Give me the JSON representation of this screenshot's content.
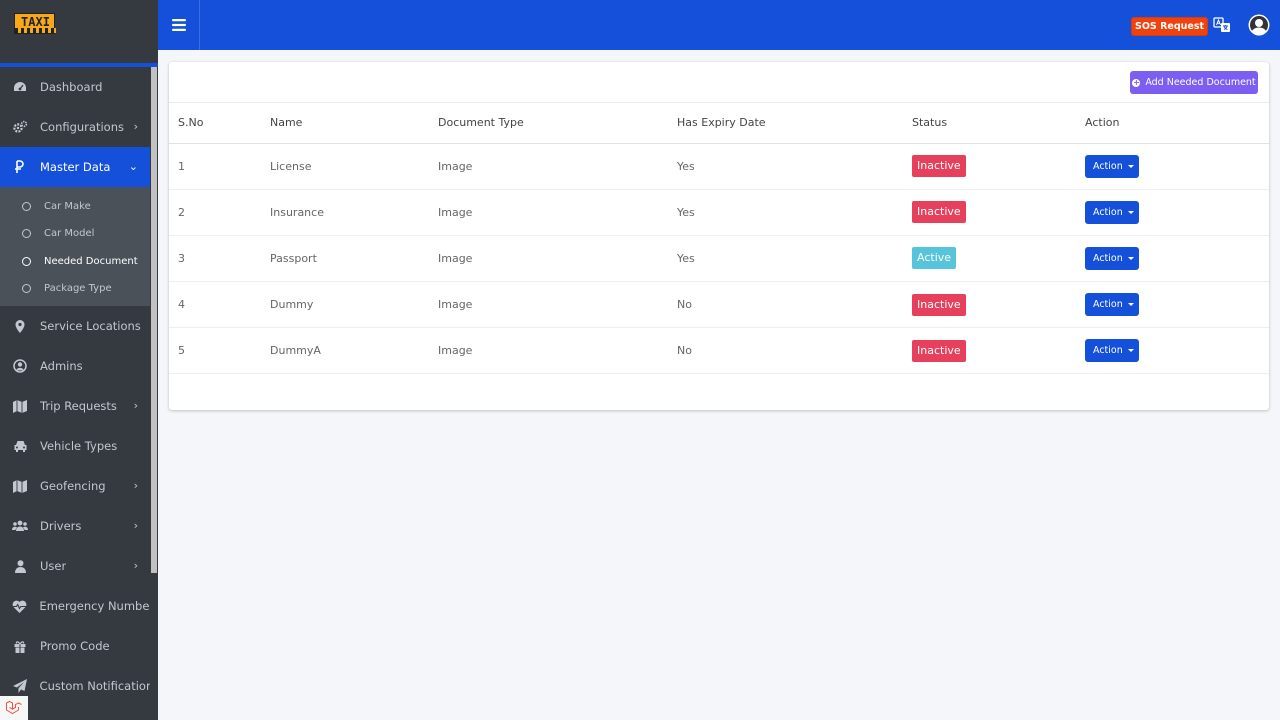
{
  "brand": {
    "logo_text": "TAXI"
  },
  "sidebar": {
    "items": [
      {
        "label": "Dashboard",
        "icon": "dashboard-icon",
        "has_chevron": false
      },
      {
        "label": "Configurations",
        "icon": "cogs-icon",
        "has_chevron": true
      },
      {
        "label": "Master Data",
        "icon": "master-data-icon",
        "has_chevron": true,
        "active": true,
        "children": [
          {
            "label": "Car Make"
          },
          {
            "label": "Car Model"
          },
          {
            "label": "Needed Document",
            "current": true
          },
          {
            "label": "Package Type"
          }
        ]
      },
      {
        "label": "Service Locations",
        "icon": "map-marker-icon",
        "has_chevron": false
      },
      {
        "label": "Admins",
        "icon": "user-circle-icon",
        "has_chevron": false
      },
      {
        "label": "Trip Requests",
        "icon": "map-icon",
        "has_chevron": true
      },
      {
        "label": "Vehicle Types",
        "icon": "car-icon",
        "has_chevron": false
      },
      {
        "label": "Geofencing",
        "icon": "map-icon",
        "has_chevron": true
      },
      {
        "label": "Drivers",
        "icon": "users-icon",
        "has_chevron": true
      },
      {
        "label": "User",
        "icon": "user-icon",
        "has_chevron": true
      },
      {
        "label": "Emergency Number",
        "icon": "heartbeat-icon",
        "has_chevron": false
      },
      {
        "label": "Promo Code",
        "icon": "gift-icon",
        "has_chevron": false
      },
      {
        "label": "Custom Notification",
        "icon": "paper-plane-icon",
        "has_chevron": false
      }
    ]
  },
  "header": {
    "sos_label": "SOS Request"
  },
  "main": {
    "add_button_label": "Add Needed Document",
    "columns": [
      "S.No",
      "Name",
      "Document Type",
      "Has Expiry Date",
      "Status",
      "Action"
    ],
    "rows": [
      {
        "sno": "1",
        "name": "License",
        "type": "Image",
        "expiry": "Yes",
        "status": "Inactive",
        "action": "Action"
      },
      {
        "sno": "2",
        "name": "Insurance",
        "type": "Image",
        "expiry": "Yes",
        "status": "Inactive",
        "action": "Action"
      },
      {
        "sno": "3",
        "name": "Passport",
        "type": "Image",
        "expiry": "Yes",
        "status": "Active",
        "action": "Action"
      },
      {
        "sno": "4",
        "name": "Dummy",
        "type": "Image",
        "expiry": "No",
        "status": "Inactive",
        "action": "Action"
      },
      {
        "sno": "5",
        "name": "DummyA",
        "type": "Image",
        "expiry": "No",
        "status": "Inactive",
        "action": "Action"
      }
    ]
  },
  "colors": {
    "primary": "#1450d9",
    "sidebar_bg": "#343a40",
    "inactive_badge": "#e6405c",
    "active_badge": "#56c4db",
    "add_button": "#7c5ef2",
    "sos": "#f0420e"
  }
}
